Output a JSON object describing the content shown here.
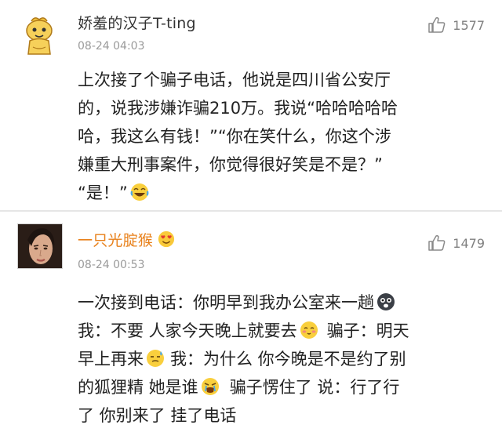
{
  "comments": [
    {
      "username": "娇羞的汉子T-ting",
      "time": "08-24 04:03",
      "likes": "1577",
      "lines": [
        "上次接了个骗子电话，他说是四川省公安厅",
        "的，说我涉嫌诈骗210万。我说“哈哈哈哈哈",
        "哈，我这么有钱！”“你在笑什么，你这个涉",
        "嫌重大刑事案件，你觉得很好笑是不是？”",
        "“是！”"
      ]
    },
    {
      "username": "一只光腚猴",
      "time": "08-24 00:53",
      "likes": "1479",
      "segments": {
        "l1": "一次接到电话：你明早到我办公室来一趟",
        "l2a": "我：不要 人家今天晚上就要去",
        "l2b": "骗子：明天",
        "l3a": "早上再来",
        "l3b": "我：为什么 你今晚是不是约了别",
        "l4a": "的狐狸精 她是谁",
        "l4b": "骗子愣住了 说：行了行",
        "l5": "了 你别来了 挂了电话"
      }
    }
  ],
  "icons": [
    "thumbs-up-icon",
    "laugh-cry-emoji",
    "heart-eyes-emoji",
    "shocked-emoji",
    "shy-emoji",
    "sweat-emoji",
    "angry-cry-emoji"
  ]
}
